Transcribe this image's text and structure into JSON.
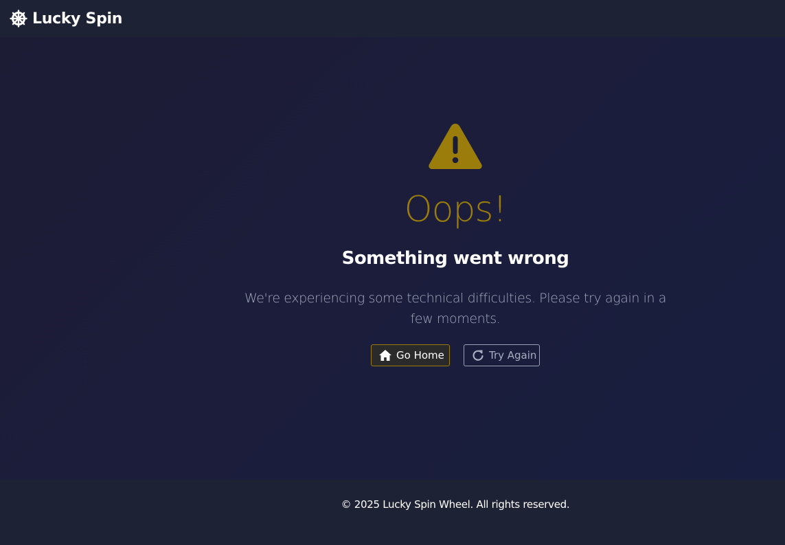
{
  "navbar": {
    "brand_label": "Lucky Spin",
    "brand_icon": "ship-wheel-icon"
  },
  "error": {
    "icon": "warning-triangle-icon",
    "heading": "Oops!",
    "subheading": "Something went wrong",
    "message": "We're experiencing some technical difficulties. Please try again in a few moments."
  },
  "actions": {
    "home_label": "Go Home",
    "home_icon": "house-icon",
    "retry_label": "Try Again",
    "retry_icon": "refresh-icon"
  },
  "footer": {
    "copyright": "© 2025 Lucky Spin Wheel. All rights reserved."
  },
  "colors": {
    "background": "#1b1e33",
    "navbar": "#1e2235",
    "accent": "#9a7d0a",
    "text_muted": "#a3a8bd"
  }
}
